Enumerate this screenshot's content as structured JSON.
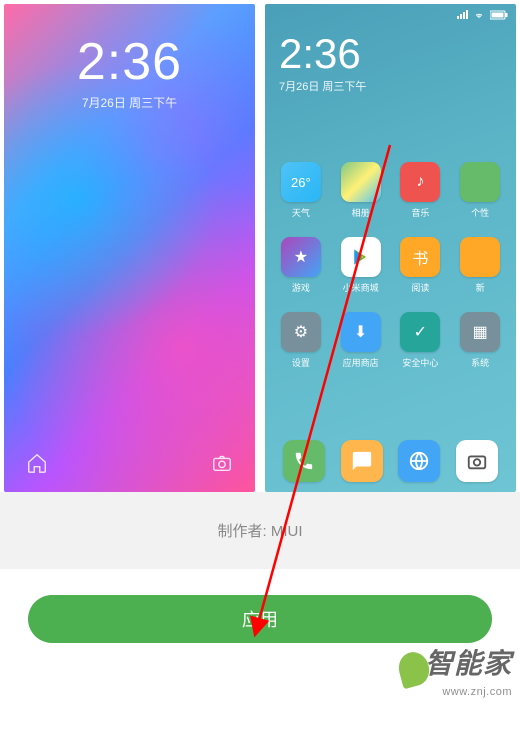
{
  "lock": {
    "time": "2:36",
    "date": "7月26日 周三下午"
  },
  "home": {
    "time": "2:36",
    "date": "7月26日 周三下午",
    "status_icons": [
      "signal",
      "wifi",
      "battery"
    ],
    "weather_temp": "26°",
    "apps": [
      {
        "label": "天气",
        "icon": "weather"
      },
      {
        "label": "相册",
        "icon": "gallery"
      },
      {
        "label": "音乐",
        "icon": "music"
      },
      {
        "label": "个性",
        "icon": "personal"
      },
      {
        "label": "游戏",
        "icon": "game"
      },
      {
        "label": "小米商城",
        "icon": "store"
      },
      {
        "label": "阅读",
        "icon": "read"
      },
      {
        "label": "新",
        "icon": "new"
      },
      {
        "label": "设置",
        "icon": "settings"
      },
      {
        "label": "应用商店",
        "icon": "appstore"
      },
      {
        "label": "安全中心",
        "icon": "security"
      },
      {
        "label": "系统",
        "icon": "system"
      }
    ],
    "dock": [
      {
        "icon": "phone"
      },
      {
        "icon": "message"
      },
      {
        "icon": "browser"
      },
      {
        "icon": "camera"
      }
    ]
  },
  "author_line": "制作者: MIUI",
  "apply_button": "应用",
  "watermark": {
    "main": "智能家",
    "sub": "www.znj.com"
  }
}
